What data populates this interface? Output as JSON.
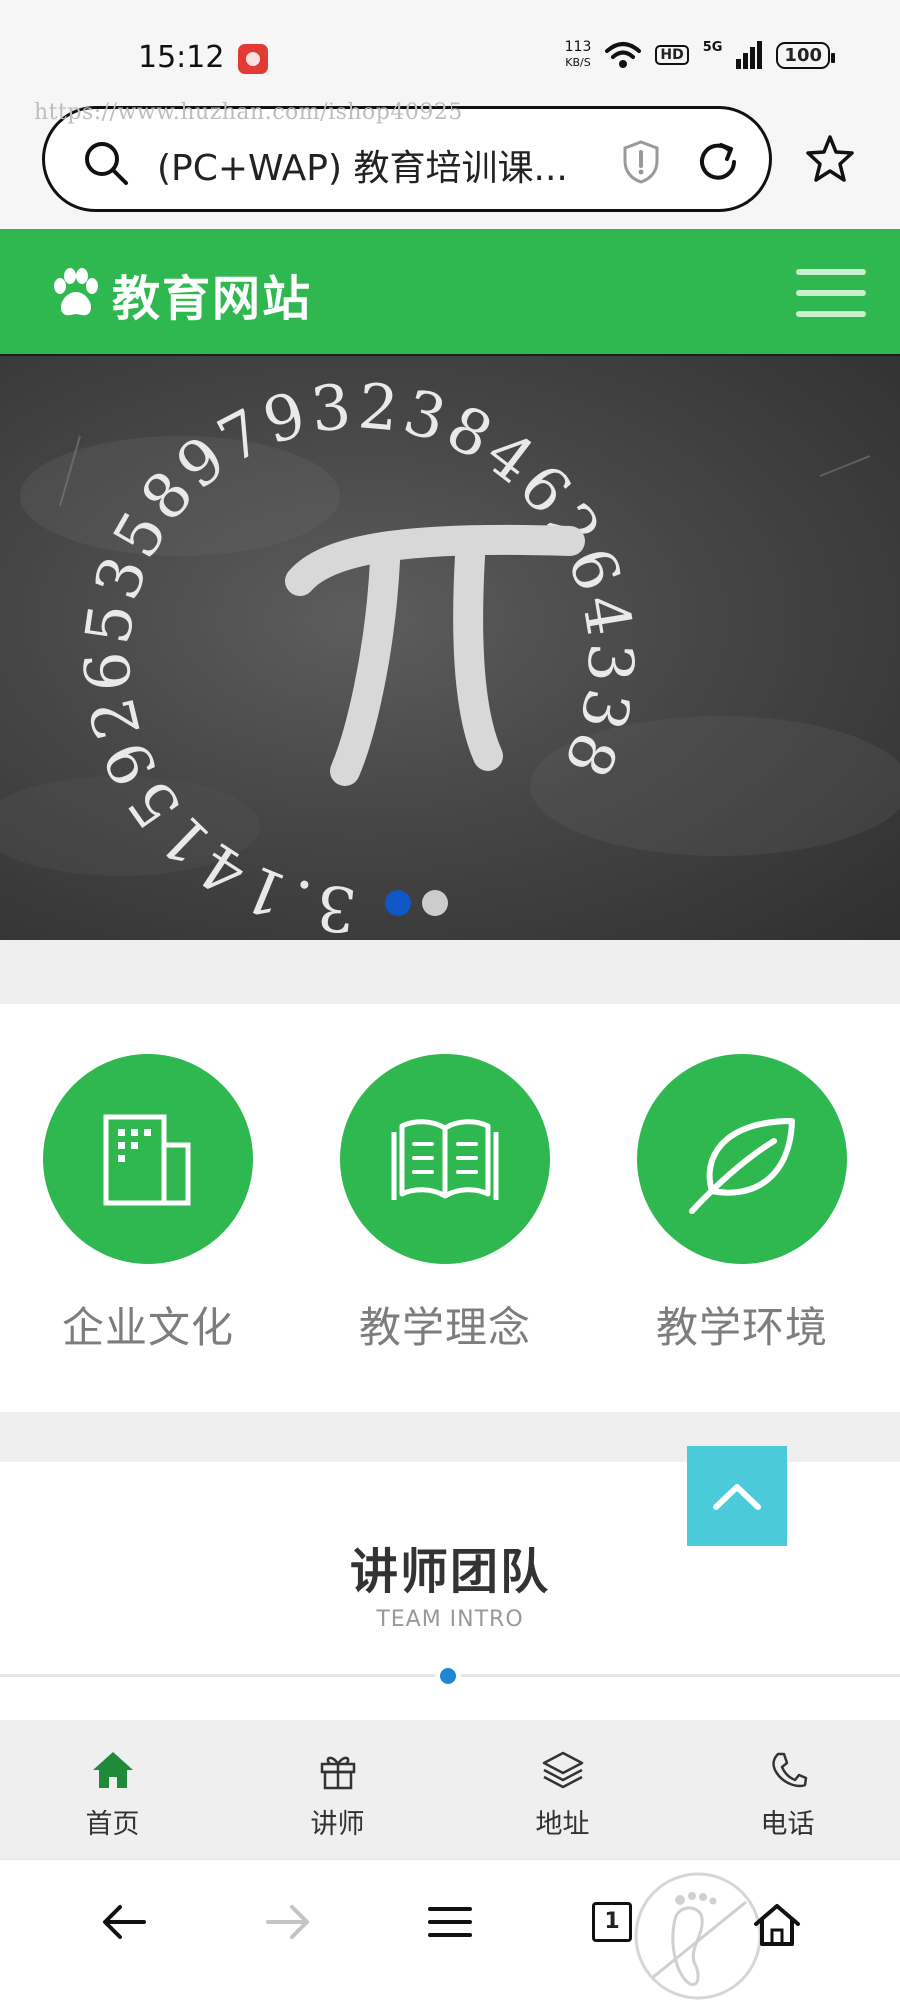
{
  "status_bar": {
    "time": "15:12",
    "net_speed_value": "113",
    "net_speed_unit": "KB/S",
    "hd_label": "HD",
    "network_label": "5G",
    "battery": "100"
  },
  "browser": {
    "watermark_url": "https://www.huzhan.com/ishop40925",
    "address_text": "(PC+WAP) 教育培训课..."
  },
  "site_header": {
    "logo_text": "教育网站"
  },
  "banner": {
    "slides": 2,
    "active_slide": 1,
    "art_text": "3.14159265358979323846264338"
  },
  "features": [
    {
      "label": "企业文化",
      "icon": "building-icon"
    },
    {
      "label": "教学理念",
      "icon": "open-book-icon"
    },
    {
      "label": "教学环境",
      "icon": "leaf-icon"
    }
  ],
  "team": {
    "title": "讲师团队",
    "subtitle": "TEAM INTRO"
  },
  "site_nav": [
    {
      "label": "首页",
      "icon": "home-icon",
      "active": true
    },
    {
      "label": "讲师",
      "icon": "gift-icon",
      "active": false
    },
    {
      "label": "地址",
      "icon": "layers-icon",
      "active": false
    },
    {
      "label": "电话",
      "icon": "phone-icon",
      "active": false
    }
  ],
  "browser_bottom": {
    "tab_count": "1"
  },
  "colors": {
    "brand_green": "#2fb84f",
    "back_to_top": "#4bcbd9",
    "active_dot": "#0f57c6",
    "team_dot": "#1e88d4"
  }
}
